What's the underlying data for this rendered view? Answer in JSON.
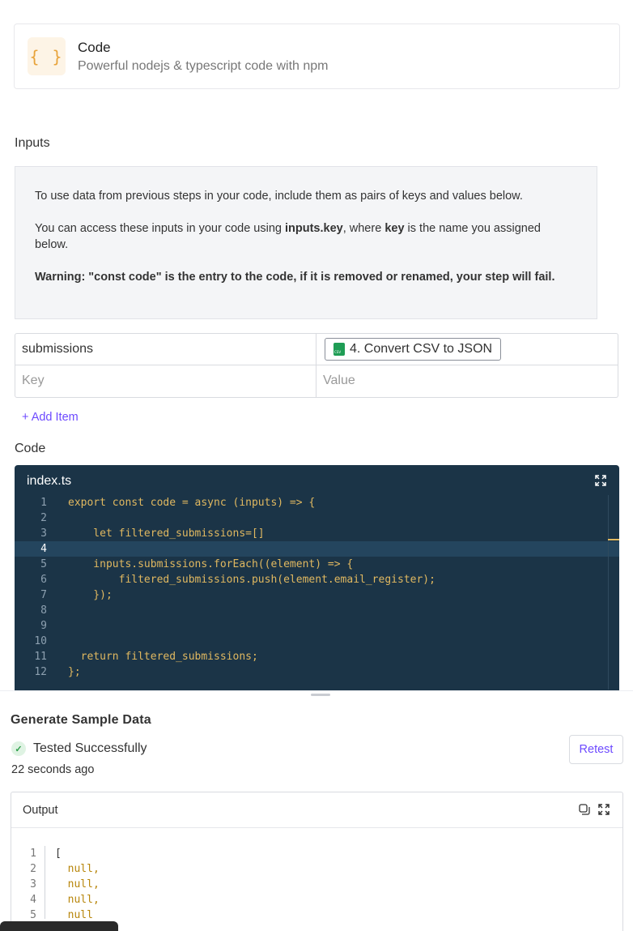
{
  "piece": {
    "icon": "{ }",
    "title": "Code",
    "description": "Powerful nodejs & typescript code with npm"
  },
  "inputs": {
    "label": "Inputs",
    "info": {
      "line1": "To use data from previous steps in your code, include them as pairs of keys and values below.",
      "line2_pre": "You can access these inputs in your code using ",
      "line2_bold1": "inputs.key",
      "line2_mid": ", where ",
      "line2_bold2": "key",
      "line2_post": " is the name you assigned below.",
      "warning": "Warning: \"const code\" is the entry to the code, if it is removed or renamed, your step will fail."
    },
    "rows": [
      {
        "key": "submissions",
        "value_step": "4. Convert CSV to JSON"
      }
    ],
    "key_placeholder": "Key",
    "value_placeholder": "Value",
    "add_item": "+ Add Item"
  },
  "code": {
    "label": "Code",
    "filename": "index.ts",
    "lines": [
      "export const code = async (inputs) => {",
      "",
      "    let filtered_submissions=[]",
      "",
      "    inputs.submissions.forEach((element) => {",
      "        filtered_submissions.push(element.email_register);",
      "    });",
      "",
      "",
      "",
      "  return filtered_submissions;",
      "};"
    ],
    "active_line": 4
  },
  "sample": {
    "title": "Generate Sample Data",
    "status": "Tested Successfully",
    "time_ago": "22 seconds ago",
    "retest_label": "Retest",
    "output_title": "Output",
    "output_lines": [
      "[",
      "  null,",
      "  null,",
      "  null,",
      "  null"
    ]
  },
  "colors": {
    "accent": "#6d4aff",
    "editor_bg": "#1b3447",
    "success": "#2e9e4a"
  }
}
